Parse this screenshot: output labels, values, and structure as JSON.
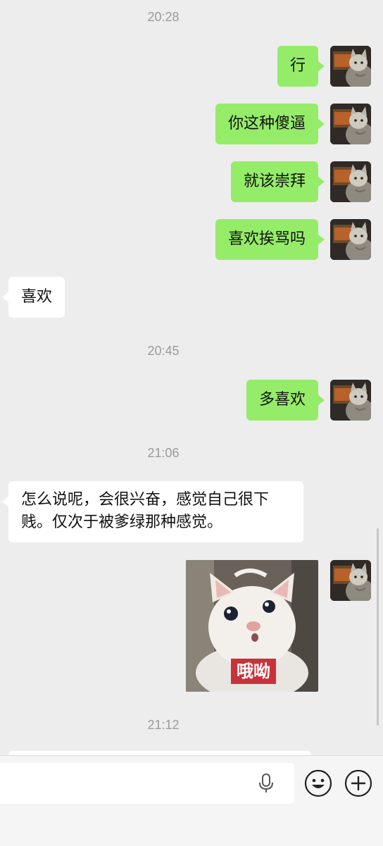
{
  "timestamps": [
    "20:28",
    "20:45",
    "21:06",
    "21:12"
  ],
  "messages": [
    {
      "side": "out",
      "text": "行"
    },
    {
      "side": "out",
      "text": "你这种傻逼"
    },
    {
      "side": "out",
      "text": "就该崇拜"
    },
    {
      "side": "out",
      "text": "喜欢挨骂吗"
    },
    {
      "side": "in",
      "text": "喜欢"
    },
    {
      "side": "out",
      "text": "多喜欢"
    },
    {
      "side": "in",
      "text": "怎么说呢，会很兴奋，感觉自己很下贱。仅次于被爹绿那种感觉。"
    }
  ],
  "sticker": {
    "label": "哦呦"
  },
  "input_bar": {
    "icons": [
      "microphone-icon",
      "emoji-icon",
      "plus-icon"
    ]
  },
  "colors": {
    "background": "#ededed",
    "outgoing_bubble": "#95ec69",
    "incoming_bubble": "#ffffff",
    "timestamp": "#9b9b9b"
  }
}
